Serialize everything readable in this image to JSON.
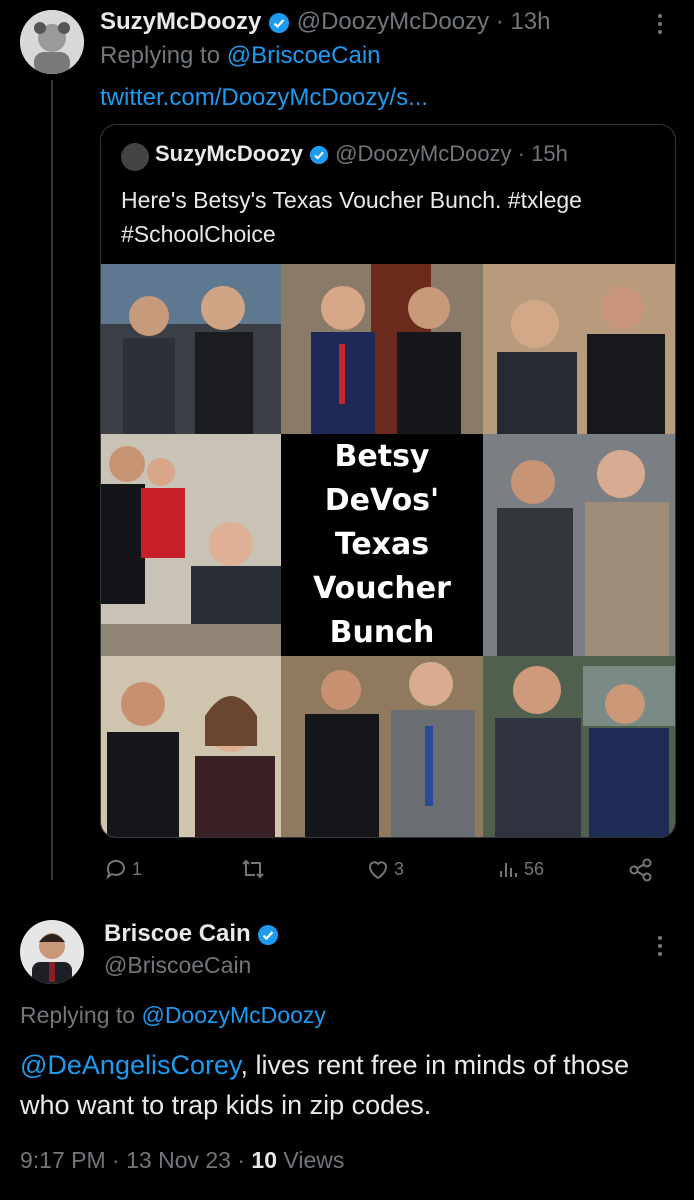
{
  "tweet1": {
    "name": "SuzyMcDoozy",
    "handle": "@DoozyMcDoozy",
    "time": "13h",
    "replying_label": "Replying to",
    "replying_to": "@BriscoeCain",
    "link": "twitter.com/DoozyMcDoozy/s..."
  },
  "quote": {
    "name": "SuzyMcDoozy",
    "handle": "@DoozyMcDoozy",
    "time": "15h",
    "text": "Here's Betsy's Texas Voucher Bunch. #txlege #SchoolChoice",
    "center_title": "Betsy DeVos' Texas Voucher Bunch"
  },
  "actions": {
    "replies": "1",
    "likes": "3",
    "views": "56"
  },
  "tweet2": {
    "name": "Briscoe Cain",
    "handle": "@BriscoeCain",
    "replying_label": "Replying to",
    "replying_to": "@DoozyMcDoozy",
    "mention": "@DeAngelisCorey",
    "text": ", lives rent free in minds of those who want to trap kids in zip codes.",
    "time": "9:17 PM",
    "date": "13 Nov 23",
    "views_count": "10",
    "views_label": "Views"
  },
  "colors": {
    "accent": "#1d9bf0",
    "muted": "#71767b",
    "background": "#000000"
  },
  "icons": [
    "verified-icon",
    "more-icon",
    "reply-icon",
    "retweet-icon",
    "like-icon",
    "views-icon",
    "share-icon"
  ]
}
